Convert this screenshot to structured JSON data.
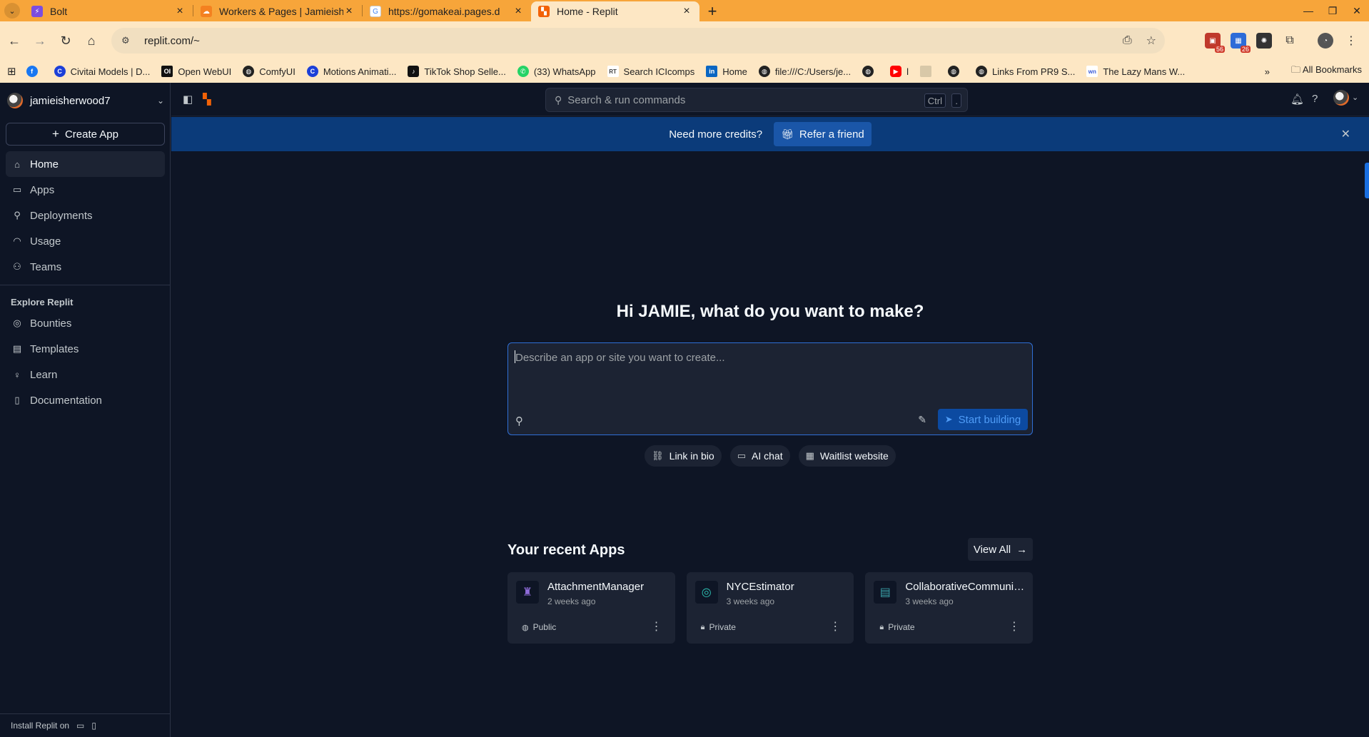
{
  "browser": {
    "tabs": [
      {
        "title": "Bolt",
        "icon": "bolt-favicon",
        "color": "#7b4de0",
        "active": false
      },
      {
        "title": "Workers & Pages | Jamieishe",
        "icon": "cloudflare-favicon",
        "color": "#f48120",
        "active": false
      },
      {
        "title": "https://gomakeai.pages.d",
        "icon": "google-favicon",
        "color": "#4285f4",
        "active": false
      },
      {
        "title": "Home - Replit",
        "icon": "replit-favicon",
        "color": "#f26207",
        "active": true
      }
    ],
    "url": "replit.com/~",
    "bookmarks": [
      {
        "label": "",
        "icon": "facebook-icon",
        "color": "#1877f2"
      },
      {
        "label": "Civitai Models | D...",
        "icon": "civitai-icon",
        "color": "#1c3fd8"
      },
      {
        "label": "Open WebUI",
        "icon": "openwebui-icon",
        "color": "#111111"
      },
      {
        "label": "ComfyUI",
        "icon": "globe-icon",
        "color": "#222222"
      },
      {
        "label": "Motions Animati...",
        "icon": "motions-icon",
        "color": "#1c3fd8"
      },
      {
        "label": "TikTok Shop Selle...",
        "icon": "tiktok-icon",
        "color": "#111111"
      },
      {
        "label": "(33) WhatsApp",
        "icon": "whatsapp-icon",
        "color": "#25d366"
      },
      {
        "label": "Search ICIcomps",
        "icon": "rt-icon",
        "color": "#444444"
      },
      {
        "label": "Home",
        "icon": "linkedin-icon",
        "color": "#0a66c2"
      },
      {
        "label": "file:///C:/Users/je...",
        "icon": "globe-icon",
        "color": "#222222"
      },
      {
        "label": "",
        "icon": "globe-icon",
        "color": "#222222"
      },
      {
        "label": "l",
        "icon": "youtube-icon",
        "color": "#ff0000"
      },
      {
        "label": "",
        "icon": "image-icon",
        "color": "#d8c8a8"
      },
      {
        "label": "",
        "icon": "globe-icon",
        "color": "#222222"
      },
      {
        "label": "Links From PR9 S...",
        "icon": "globe-icon",
        "color": "#222222"
      },
      {
        "label": "The Lazy Mans W...",
        "icon": "wn-icon",
        "color": "#3a5bd8"
      }
    ],
    "all_bookmarks_label": "All Bookmarks",
    "extension_badges": [
      "56",
      "26"
    ]
  },
  "sidebar": {
    "username": "jamieisherwood7",
    "create_label": "Create App",
    "nav": [
      {
        "label": "Home",
        "icon": "home-icon",
        "active": true
      },
      {
        "label": "Apps",
        "icon": "folder-icon",
        "active": false
      },
      {
        "label": "Deployments",
        "icon": "rocket-icon",
        "active": false
      },
      {
        "label": "Usage",
        "icon": "gauge-icon",
        "active": false
      },
      {
        "label": "Teams",
        "icon": "users-icon",
        "active": false
      }
    ],
    "explore_title": "Explore Replit",
    "explore": [
      {
        "label": "Bounties",
        "icon": "target-icon"
      },
      {
        "label": "Templates",
        "icon": "template-icon"
      },
      {
        "label": "Learn",
        "icon": "lightbulb-icon"
      },
      {
        "label": "Documentation",
        "icon": "book-icon"
      }
    ],
    "install_label": "Install Replit on"
  },
  "topbar": {
    "search_placeholder": "Search & run commands",
    "shortcut_ctrl": "Ctrl",
    "shortcut_key": "."
  },
  "banner": {
    "text": "Need more credits?",
    "button": "Refer a friend"
  },
  "main": {
    "greeting": "Hi JAMIE, what do you want to make?",
    "prompt_placeholder": "Describe an app or site you want to create...",
    "start_label": "Start building",
    "chips": [
      {
        "label": "Link in bio",
        "icon": "link-icon"
      },
      {
        "label": "AI chat",
        "icon": "chat-icon"
      },
      {
        "label": "Waitlist website",
        "icon": "calendar-icon"
      }
    ],
    "recent_title": "Your recent Apps",
    "view_all": "View All",
    "apps": [
      {
        "name": "AttachmentManager",
        "time": "2 weeks ago",
        "visibility": "Public",
        "visibility_icon": "globe-icon"
      },
      {
        "name": "NYCEstimator",
        "time": "3 weeks ago",
        "visibility": "Private",
        "visibility_icon": "lock-icon"
      },
      {
        "name": "CollaborativeCommunic...",
        "time": "3 weeks ago",
        "visibility": "Private",
        "visibility_icon": "lock-icon"
      }
    ]
  },
  "colors": {
    "background": "#0e1525",
    "surface": "#1c2333",
    "accent": "#0c4aa1",
    "banner": "#0b3b7a",
    "browser_chrome": "#f7a53a"
  }
}
